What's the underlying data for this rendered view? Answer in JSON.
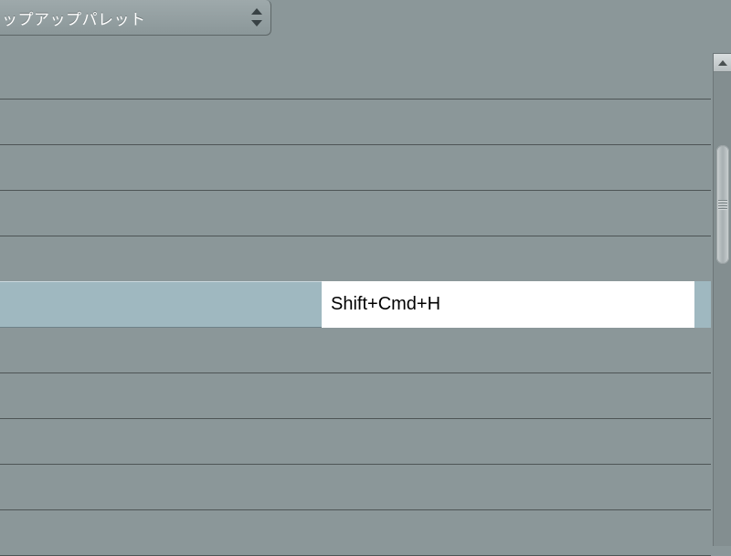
{
  "dropdown": {
    "label": "ップアップパレット"
  },
  "rows": [
    {
      "selected": false,
      "shortcut": ""
    },
    {
      "selected": false,
      "shortcut": ""
    },
    {
      "selected": false,
      "shortcut": ""
    },
    {
      "selected": false,
      "shortcut": ""
    },
    {
      "selected": false,
      "shortcut": ""
    },
    {
      "selected": true,
      "shortcut": "Shift+Cmd+H"
    },
    {
      "selected": false,
      "shortcut": ""
    },
    {
      "selected": false,
      "shortcut": ""
    },
    {
      "selected": false,
      "shortcut": ""
    },
    {
      "selected": false,
      "shortcut": ""
    }
  ]
}
